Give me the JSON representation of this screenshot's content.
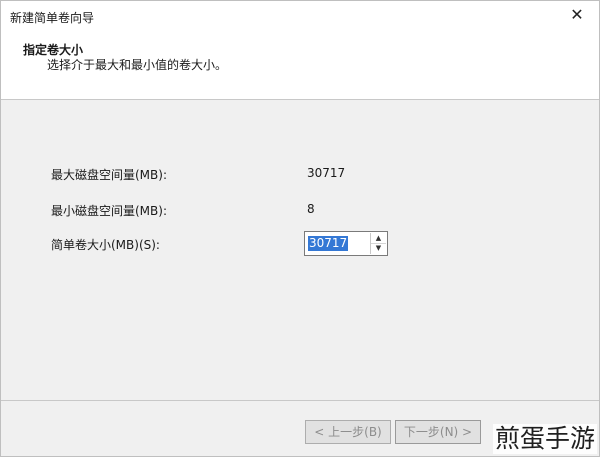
{
  "window": {
    "title": "新建简单卷向导"
  },
  "header": {
    "title": "指定卷大小",
    "subtitle": "选择介于最大和最小值的卷大小。"
  },
  "fields": [
    {
      "label": "最大磁盘空间量(MB):",
      "value": "30717"
    },
    {
      "label": "最小磁盘空间量(MB):",
      "value": "8"
    },
    {
      "label": "简单卷大小(MB)(S):",
      "value": "30717"
    }
  ],
  "buttons": {
    "back": "< 上一步(B)",
    "next": "下一步(N) >"
  },
  "watermark": "煎蛋手游",
  "colors": {
    "selection": "#3478d5",
    "content_bg": "#f0f0f0"
  },
  "icons": {
    "close": "close-icon",
    "spin_up": "arrow-up-icon",
    "spin_down": "arrow-down-icon"
  }
}
